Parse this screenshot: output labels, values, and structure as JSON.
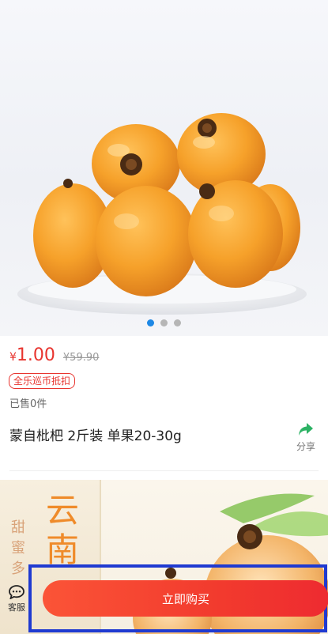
{
  "carousel": {
    "total_slides": 3,
    "active_slide": 1
  },
  "product": {
    "currency_symbol": "¥",
    "price": "1.00",
    "original_price": "¥59.90",
    "coin_badge": "全乐巡币抵扣",
    "sold": "已售0件",
    "title": "蒙自枇杷 2斤装 单果20-30g"
  },
  "share": {
    "label": "分享"
  },
  "detail_banner": {
    "big_text": "云南",
    "small_text": "甜蜜多"
  },
  "bottom_bar": {
    "customer_service_label": "客服",
    "buy_label": "立即购买"
  },
  "colors": {
    "price_red": "#e8352f",
    "active_dot": "#1e88e5",
    "buy_button": "#f23b2e",
    "highlight_border": "#1f3ad1",
    "share_green": "#2cb264"
  },
  "icons": {
    "customer_service": "chat-bubble-icon",
    "share": "share-arrow-icon"
  }
}
